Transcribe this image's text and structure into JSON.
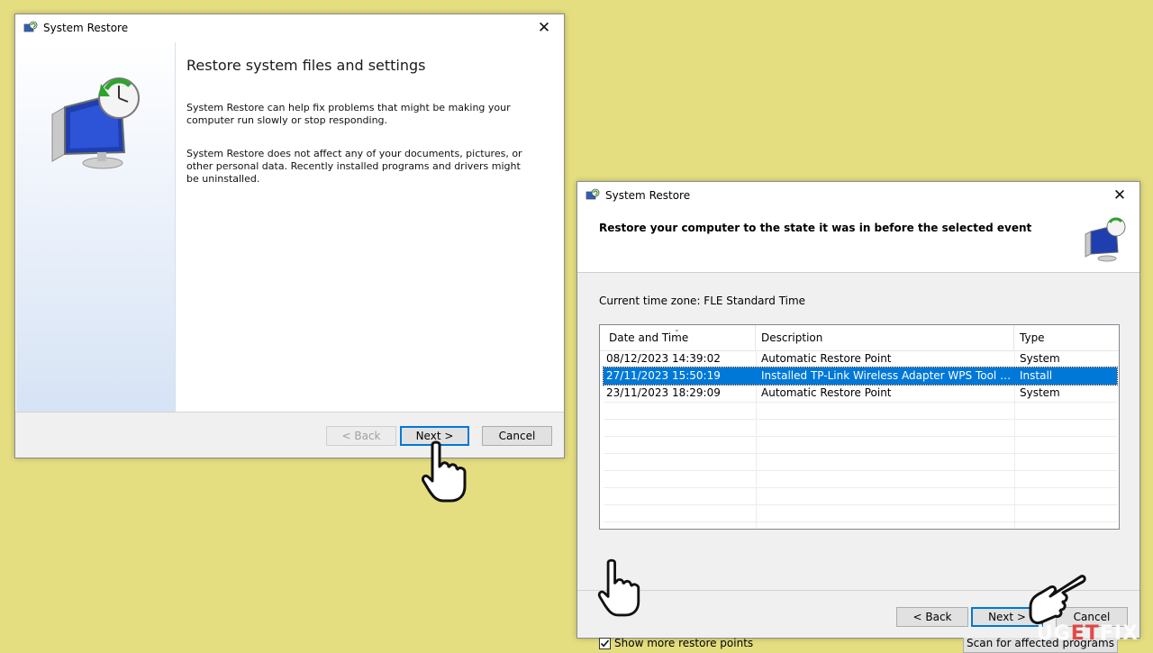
{
  "window1": {
    "title": "System Restore",
    "heading": "Restore system files and settings",
    "para1": "System Restore can help fix problems that might be making your computer run slowly or stop responding.",
    "para2": "System Restore does not affect any of your documents, pictures, or other personal data. Recently installed programs and drivers might be uninstalled.",
    "back_label": "< Back",
    "next_label": "Next >",
    "cancel_label": "Cancel"
  },
  "window2": {
    "title": "System Restore",
    "heading": "Restore your computer to the state it was in before the selected event",
    "timezone": "Current time zone: FLE Standard Time",
    "columns": [
      "Date and Time",
      "Description",
      "Type"
    ],
    "rows": [
      {
        "date": "08/12/2023 14:39:02",
        "desc": "Automatic Restore Point",
        "type": "System",
        "selected": false
      },
      {
        "date": "27/11/2023 15:50:19",
        "desc": "Installed TP-Link Wireless Adapter WPS Tool and ...",
        "type": "Install",
        "selected": true
      },
      {
        "date": "23/11/2023 18:29:09",
        "desc": "Automatic Restore Point",
        "type": "System",
        "selected": false
      }
    ],
    "show_more_label": "Show more restore points",
    "show_more_checked": true,
    "scan_label": "Scan for affected programs",
    "back_label": "< Back",
    "next_label": "Next >",
    "cancel_label": "Cancel"
  },
  "watermark": {
    "part1": "UG",
    "part2": "ET",
    "part3": "FIX"
  },
  "colors": {
    "background": "#e5de80",
    "selection": "#0078d7",
    "default_button_border": "#0078d7"
  }
}
